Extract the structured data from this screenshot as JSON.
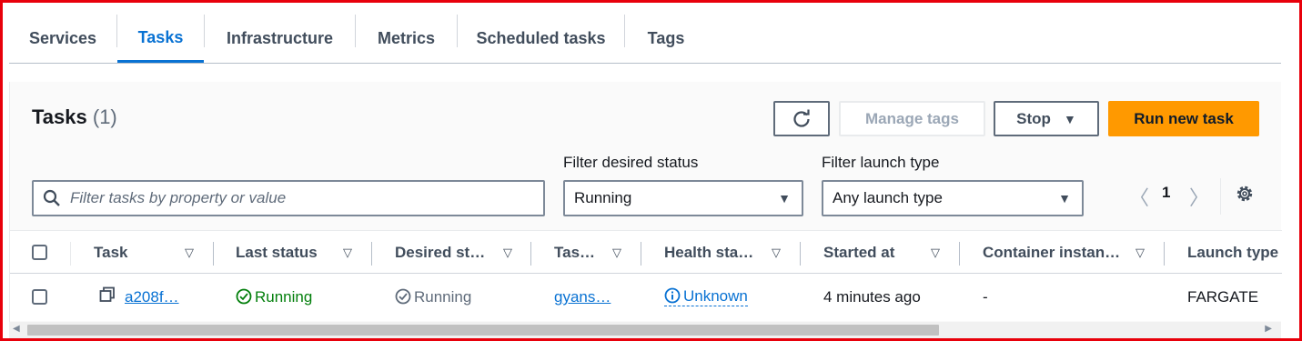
{
  "tabs": [
    {
      "label": "Services"
    },
    {
      "label": "Tasks",
      "active": true
    },
    {
      "label": "Infrastructure"
    },
    {
      "label": "Metrics"
    },
    {
      "label": "Scheduled tasks"
    },
    {
      "label": "Tags"
    }
  ],
  "panel": {
    "title": "Tasks",
    "count": "(1)",
    "buttons": {
      "refresh_icon": "refresh-icon",
      "manage_tags": "Manage tags",
      "stop": "Stop",
      "run_new_task": "Run new task"
    },
    "search": {
      "placeholder": "Filter tasks by property or value",
      "icon": "search-icon"
    },
    "filters": {
      "desired_status_label": "Filter desired status",
      "desired_status_value": "Running",
      "launch_type_label": "Filter launch type",
      "launch_type_value": "Any launch type"
    },
    "pagination": {
      "page": "1"
    }
  },
  "table": {
    "columns": [
      "Task",
      "Last status",
      "Desired st…",
      "Tas…",
      "Health sta…",
      "Started at",
      "Container instan…",
      "Launch type"
    ],
    "rows": [
      {
        "task": "a208f…",
        "last_status": "Running",
        "desired_status": "Running",
        "task_definition": "gyans…",
        "health_status": "Unknown",
        "started_at": "4 minutes ago",
        "container_instance": "-",
        "launch_type": "FARGATE"
      }
    ]
  },
  "colors": {
    "accent": "#0972d3",
    "primary_button": "#ff9900",
    "running_green": "#037f0c",
    "frame_red": "#e8000b"
  }
}
